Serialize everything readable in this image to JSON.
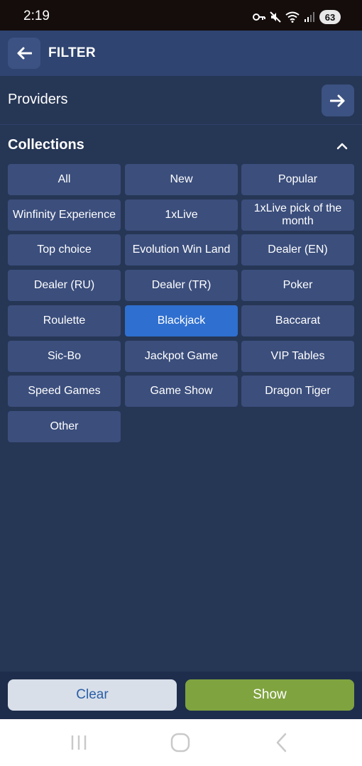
{
  "status_bar": {
    "time": "2:19",
    "battery": "63",
    "icons": [
      "key-icon",
      "mute-icon",
      "wifi-icon",
      "signal-icon",
      "battery-icon"
    ]
  },
  "header": {
    "title": "FILTER",
    "back_icon": "arrow-left-icon"
  },
  "providers": {
    "label": "Providers",
    "icon": "arrow-right-icon"
  },
  "collections": {
    "title": "Collections",
    "collapse_icon": "chevron-up-icon",
    "items": [
      {
        "label": "All",
        "selected": false
      },
      {
        "label": "New",
        "selected": false
      },
      {
        "label": "Popular",
        "selected": false
      },
      {
        "label": "Winfinity Experience",
        "selected": false
      },
      {
        "label": "1xLive",
        "selected": false
      },
      {
        "label": "1xLive pick of the month",
        "selected": false
      },
      {
        "label": "Top choice",
        "selected": false
      },
      {
        "label": "Evolution Win Land",
        "selected": false
      },
      {
        "label": "Dealer (EN)",
        "selected": false
      },
      {
        "label": "Dealer (RU)",
        "selected": false
      },
      {
        "label": "Dealer (TR)",
        "selected": false
      },
      {
        "label": "Poker",
        "selected": false
      },
      {
        "label": "Roulette",
        "selected": false
      },
      {
        "label": "Blackjack",
        "selected": true
      },
      {
        "label": "Baccarat",
        "selected": false
      },
      {
        "label": "Sic-Bo",
        "selected": false
      },
      {
        "label": "Jackpot Game",
        "selected": false
      },
      {
        "label": "VIP Tables",
        "selected": false
      },
      {
        "label": "Speed Games",
        "selected": false
      },
      {
        "label": "Game Show",
        "selected": false
      },
      {
        "label": "Dragon Tiger",
        "selected": false
      },
      {
        "label": "Other",
        "selected": false
      }
    ]
  },
  "actions": {
    "clear_label": "Clear",
    "show_label": "Show"
  },
  "nav": {
    "icons": [
      "recent-apps-icon",
      "home-icon",
      "back-icon"
    ]
  },
  "colors": {
    "background": "#263655",
    "header": "#2f4470",
    "chip": "#3b4e7c",
    "chip_selected": "#2f6fcf",
    "clear_button": "#d8dfe9",
    "show_button": "#7fa33f"
  }
}
